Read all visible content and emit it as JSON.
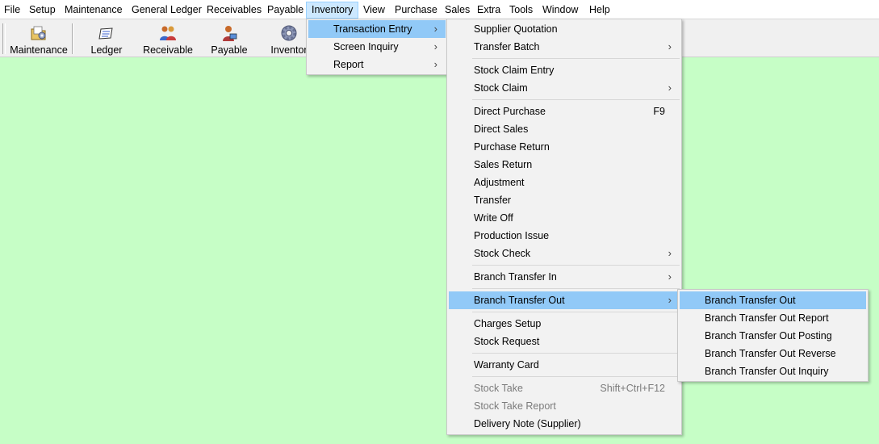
{
  "menubar": {
    "items": [
      "File",
      "Setup",
      "Maintenance",
      "General Ledger",
      "Receivables",
      "Payable",
      "Inventory",
      "View",
      "Purchase",
      "Sales",
      "Extra",
      "Tools",
      "Window",
      "Help"
    ],
    "active": "Inventory"
  },
  "toolbar": {
    "buttons": [
      {
        "label": "Maintenance",
        "icon": "folder-gear-icon"
      },
      {
        "label": "Ledger",
        "icon": "ledger-book-icon"
      },
      {
        "label": "Receivable",
        "icon": "people-icon"
      },
      {
        "label": "Payable",
        "icon": "person-money-icon"
      },
      {
        "label": "Inventor",
        "icon": "gear-icon"
      }
    ]
  },
  "inventory_menu": {
    "items": [
      {
        "label": "Transaction Entry",
        "submenu": true,
        "highlighted": true
      },
      {
        "label": "Screen Inquiry",
        "submenu": true
      },
      {
        "label": "Report",
        "submenu": true
      }
    ]
  },
  "transaction_menu": {
    "items": [
      {
        "label": "Supplier Quotation"
      },
      {
        "label": "Transfer Batch",
        "submenu": true
      },
      {
        "label": "Stock Claim Entry"
      },
      {
        "label": "Stock Claim",
        "submenu": true
      },
      {
        "label": "Direct Purchase",
        "shortcut": "F9"
      },
      {
        "label": "Direct Sales"
      },
      {
        "label": "Purchase Return"
      },
      {
        "label": "Sales Return"
      },
      {
        "label": "Adjustment"
      },
      {
        "label": "Transfer"
      },
      {
        "label": "Write Off"
      },
      {
        "label": "Production Issue"
      },
      {
        "label": "Stock Check",
        "submenu": true
      },
      {
        "label": "Branch Transfer In",
        "submenu": true
      },
      {
        "label": "Branch Transfer Out",
        "submenu": true,
        "highlighted": true
      },
      {
        "label": "Charges Setup"
      },
      {
        "label": "Stock Request"
      },
      {
        "label": "Warranty Card"
      },
      {
        "label": "Stock Take",
        "shortcut": "Shift+Ctrl+F12",
        "disabled": true
      },
      {
        "label": "Stock Take Report",
        "disabled": true
      },
      {
        "label": "Delivery Note (Supplier)"
      }
    ]
  },
  "branch_out_menu": {
    "items": [
      {
        "label": "Branch Transfer Out",
        "highlighted": true
      },
      {
        "label": "Branch Transfer Out Report"
      },
      {
        "label": "Branch Transfer Out Posting"
      },
      {
        "label": "Branch Transfer Out Reverse"
      },
      {
        "label": "Branch Transfer Out Inquiry"
      }
    ]
  },
  "colors": {
    "background": "#c6fec6",
    "menu_highlight": "#91c9f7",
    "menubar_active": "#cce8ff"
  }
}
